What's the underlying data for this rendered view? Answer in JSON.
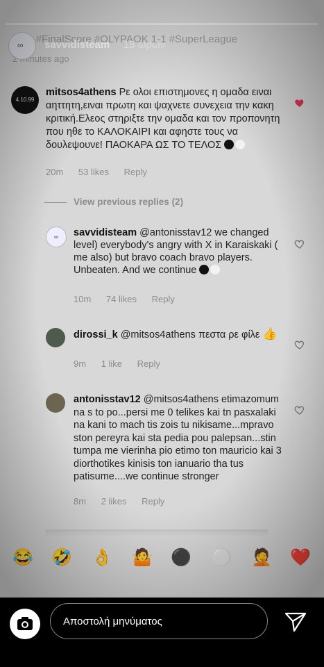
{
  "story": {
    "username": "savvidisteam",
    "time": "18 ωρών",
    "caption": "k_fc #FinalScore #OLYPAOK 1-1 #SuperLeague",
    "caption_time": "2 minutes ago"
  },
  "comments": [
    {
      "avatar_text": "4.10.99",
      "username": "mitsos4athens",
      "text": "Ρε ολοι επιστημονες η ομαδα ειναι αηττητη,ειναι πρωτη και ψαχνετε συνεχεια την κακη κριτική.Ελεος στηριξτε την ομαδα και τον προπονητη που ηθε το ΚΑΛΟΚΑΙΡΙ και αφηστε τους να δουλεψουνε! ΠΑΟΚΑΡΑ ΩΣ ΤΟ ΤΕΛΟΣ",
      "time": "20m",
      "likes": "53 likes",
      "reply": "Reply"
    }
  ],
  "view_previous": "View previous replies (2)",
  "replies": [
    {
      "username": "savvidisteam",
      "text": "@antonisstav12 we changed level) everybody's angry with X in Karaiskaki ( me also) but bravo  coach bravo players. Unbeaten. And we continue",
      "time": "10m",
      "likes": "74 likes",
      "reply": "Reply"
    },
    {
      "username": "dirossi_k",
      "text": "@mitsos4athens πεστα ρε φίλε",
      "time": "9m",
      "likes": "1 like",
      "reply": "Reply"
    },
    {
      "username": "antonisstav12",
      "text": "@mitsos4athens etimazomum na s to po...persi me 0 telikes kai tn pasxalaki na kani to mach tis zois tu nikisame...mpravo ston pereyra kai sta pedia pou palepsan...stin tumpa me vierinha pio etimo ton mauricio kai 3 diorthotikes kinisis ton ianuario tha tus patisume....we continue stronger",
      "time": "8m",
      "likes": "2 likes",
      "reply": "Reply"
    }
  ],
  "emoji_bar": [
    "😂",
    "🤣",
    "👌",
    "🤷",
    "⚫",
    "⚪",
    "🤦",
    "❤️"
  ],
  "message_bar": {
    "placeholder": "Αποστολή μηνύματος"
  },
  "colors": {
    "liked_heart": "#d9394f",
    "meta_gray": "#8c8c8c"
  }
}
